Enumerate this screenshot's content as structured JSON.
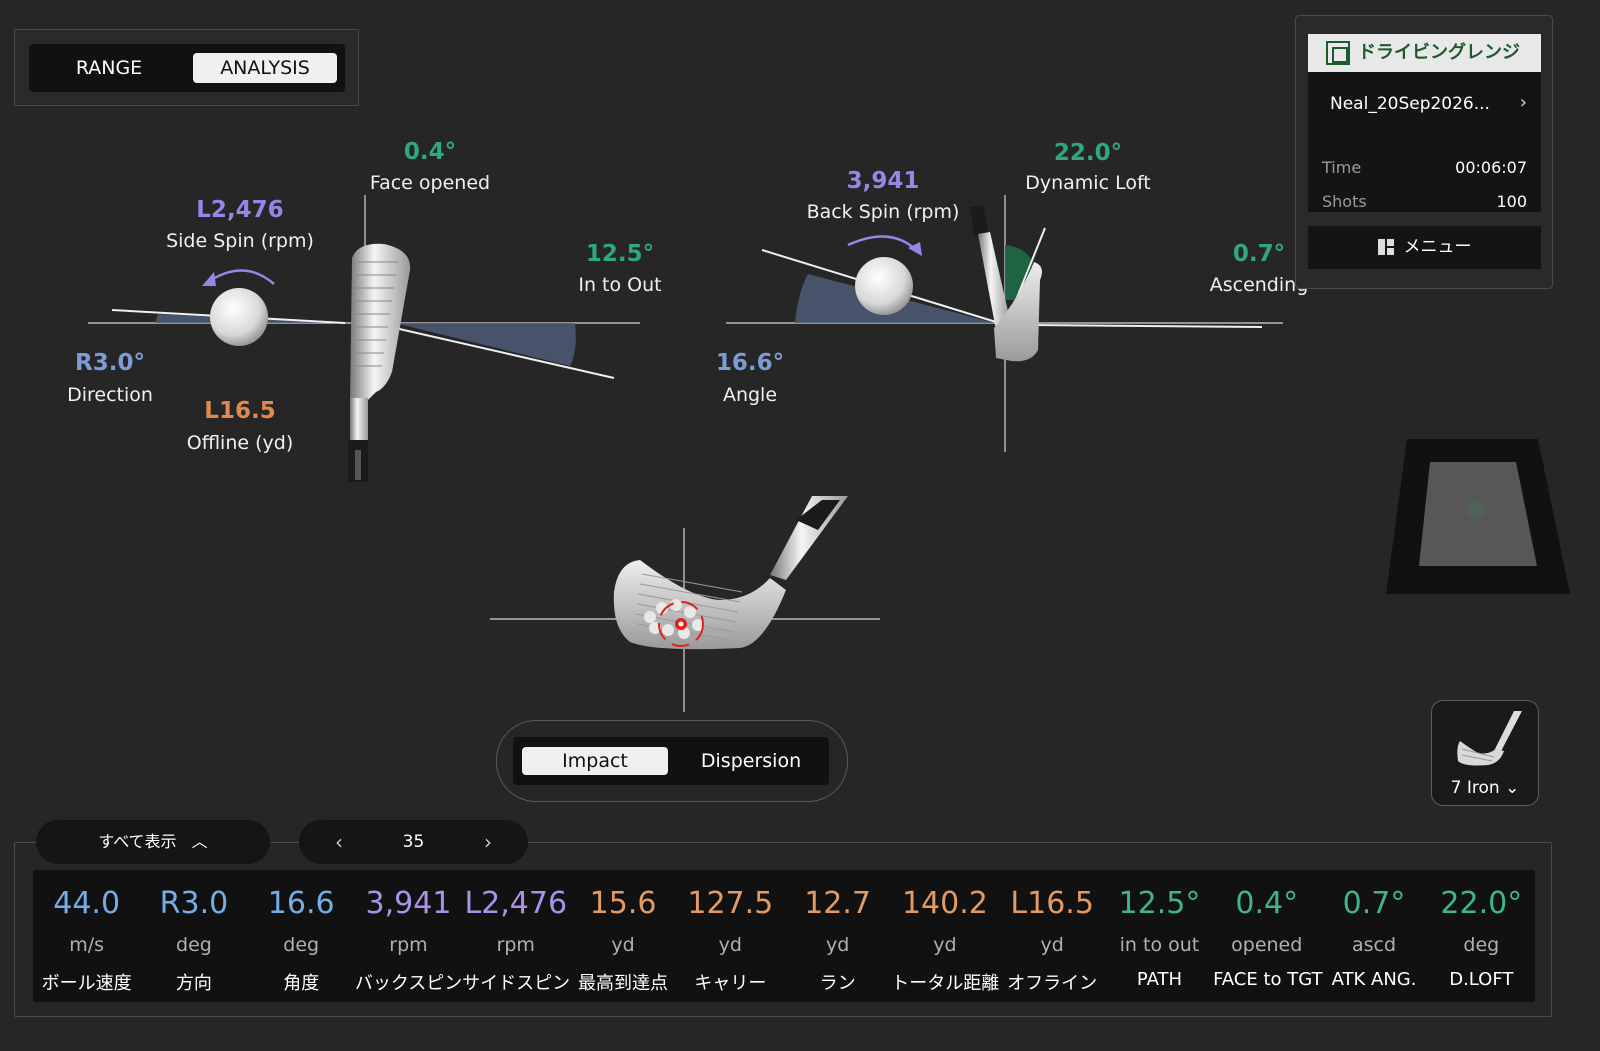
{
  "mode_toggle": {
    "range": "RANGE",
    "analysis": "ANALYSIS",
    "active": "ANALYSIS"
  },
  "top_view": {
    "face": {
      "value": "0.4°",
      "label": "Face opened"
    },
    "side_spin": {
      "value": "L2,476",
      "label": "Side Spin (rpm)"
    },
    "path": {
      "value": "12.5°",
      "label": "In to Out"
    },
    "direction": {
      "value": "R3.0°",
      "label": "Direction"
    },
    "offline": {
      "value": "L16.5",
      "label": "Offline (yd)"
    }
  },
  "side_view": {
    "back_spin": {
      "value": "3,941",
      "label": "Back Spin (rpm)"
    },
    "loft": {
      "value": "22.0°",
      "label": "Dynamic Loft"
    },
    "attack": {
      "value": "0.7°",
      "label": "Ascending"
    },
    "angle": {
      "value": "16.6°",
      "label": "Angle"
    }
  },
  "session": {
    "title": "ドライビングレンジ",
    "name": "Neal_20Sep2026...",
    "time_label": "Time",
    "time_value": "00:06:07",
    "shots_label": "Shots",
    "shots_value": "100",
    "menu_label": "メニュー"
  },
  "view_toggle": {
    "impact": "Impact",
    "dispersion": "Dispersion",
    "active": "Impact"
  },
  "club": {
    "label": "7 Iron"
  },
  "bottom": {
    "show_all": "すべて表示",
    "shot_number": "35",
    "metrics": [
      {
        "value": "44.0",
        "unit": "m/s",
        "name": "ボール速度",
        "color": "blue"
      },
      {
        "value": "R3.0",
        "unit": "deg",
        "name": "方向",
        "color": "blue"
      },
      {
        "value": "16.6",
        "unit": "deg",
        "name": "角度",
        "color": "blue"
      },
      {
        "value": "3,941",
        "unit": "rpm",
        "name": "バックスピン",
        "color": "purple"
      },
      {
        "value": "L2,476",
        "unit": "rpm",
        "name": "サイドスピン",
        "color": "purple"
      },
      {
        "value": "15.6",
        "unit": "yd",
        "name": "最高到達点",
        "color": "orange"
      },
      {
        "value": "127.5",
        "unit": "yd",
        "name": "キャリー",
        "color": "orange"
      },
      {
        "value": "12.7",
        "unit": "yd",
        "name": "ラン",
        "color": "orange"
      },
      {
        "value": "140.2",
        "unit": "yd",
        "name": "トータル距離",
        "color": "orange"
      },
      {
        "value": "L16.5",
        "unit": "yd",
        "name": "オフライン",
        "color": "orange"
      },
      {
        "value": "12.5°",
        "unit": "in to out",
        "name": "PATH",
        "color": "green"
      },
      {
        "value": "0.4°",
        "unit": "opened",
        "name": "FACE to TGT",
        "color": "green"
      },
      {
        "value": "0.7°",
        "unit": "ascd",
        "name": "ATK ANG.",
        "color": "green"
      },
      {
        "value": "22.0°",
        "unit": "deg",
        "name": "D.LOFT",
        "color": "green"
      }
    ]
  }
}
